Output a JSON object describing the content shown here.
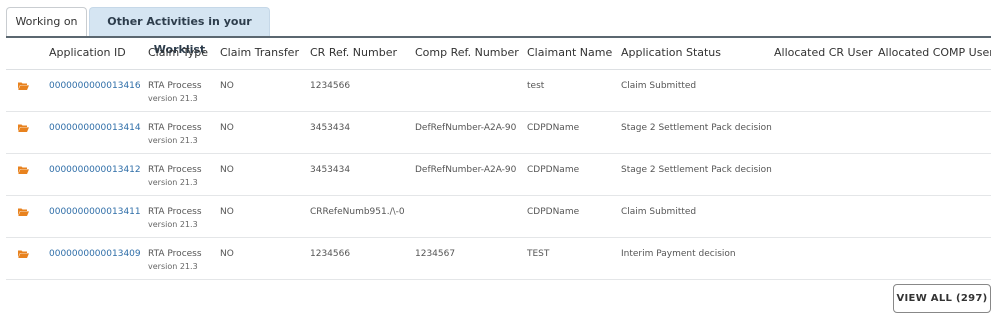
{
  "tabs": [
    {
      "label": "Working on",
      "active": false
    },
    {
      "label": "Other Activities in your Worklist",
      "active": true
    }
  ],
  "table": {
    "headers": [
      "Application ID",
      "Claim Type",
      "Claim Transfer",
      "CR Ref. Number",
      "Comp Ref. Number",
      "Claimant Name",
      "Application Status",
      "Allocated CR User",
      "Allocated COMP User"
    ],
    "rows": [
      {
        "app_id": "0000000000013416",
        "claim_type": "RTA Process",
        "claim_version": "version 21.3",
        "claim_transfer": "NO",
        "cr_ref": "1234566",
        "comp_ref": "",
        "claimant": "test",
        "status": "Claim Submitted",
        "cr_user": "",
        "comp_user": ""
      },
      {
        "app_id": "0000000000013414",
        "claim_type": "RTA Process",
        "claim_version": "version 21.3",
        "claim_transfer": "NO",
        "cr_ref": "3453434",
        "comp_ref": "DefRefNumber-A2A-90",
        "claimant": "CDPDName",
        "status": "Stage 2 Settlement Pack decision",
        "cr_user": "",
        "comp_user": ""
      },
      {
        "app_id": "0000000000013412",
        "claim_type": "RTA Process",
        "claim_version": "version 21.3",
        "claim_transfer": "NO",
        "cr_ref": "3453434",
        "comp_ref": "DefRefNumber-A2A-90",
        "claimant": "CDPDName",
        "status": "Stage 2 Settlement Pack decision",
        "cr_user": "",
        "comp_user": ""
      },
      {
        "app_id": "0000000000013411",
        "claim_type": "RTA Process",
        "claim_version": "version 21.3",
        "claim_transfer": "NO",
        "cr_ref": "CRRefeNumb951./\\-0",
        "comp_ref": "",
        "claimant": "CDPDName",
        "status": "Claim Submitted",
        "cr_user": "",
        "comp_user": ""
      },
      {
        "app_id": "0000000000013409",
        "claim_type": "RTA Process",
        "claim_version": "version 21.3",
        "claim_transfer": "NO",
        "cr_ref": "1234566",
        "comp_ref": "1234567",
        "claimant": "TEST",
        "status": "Interim Payment decision",
        "cr_user": "",
        "comp_user": ""
      }
    ],
    "row_icon": "folder-open-icon",
    "icon_color": "#e8821e",
    "link_color": "#2f6ea8"
  },
  "footer": {
    "view_all_label": "VIEW ALL (297)"
  }
}
